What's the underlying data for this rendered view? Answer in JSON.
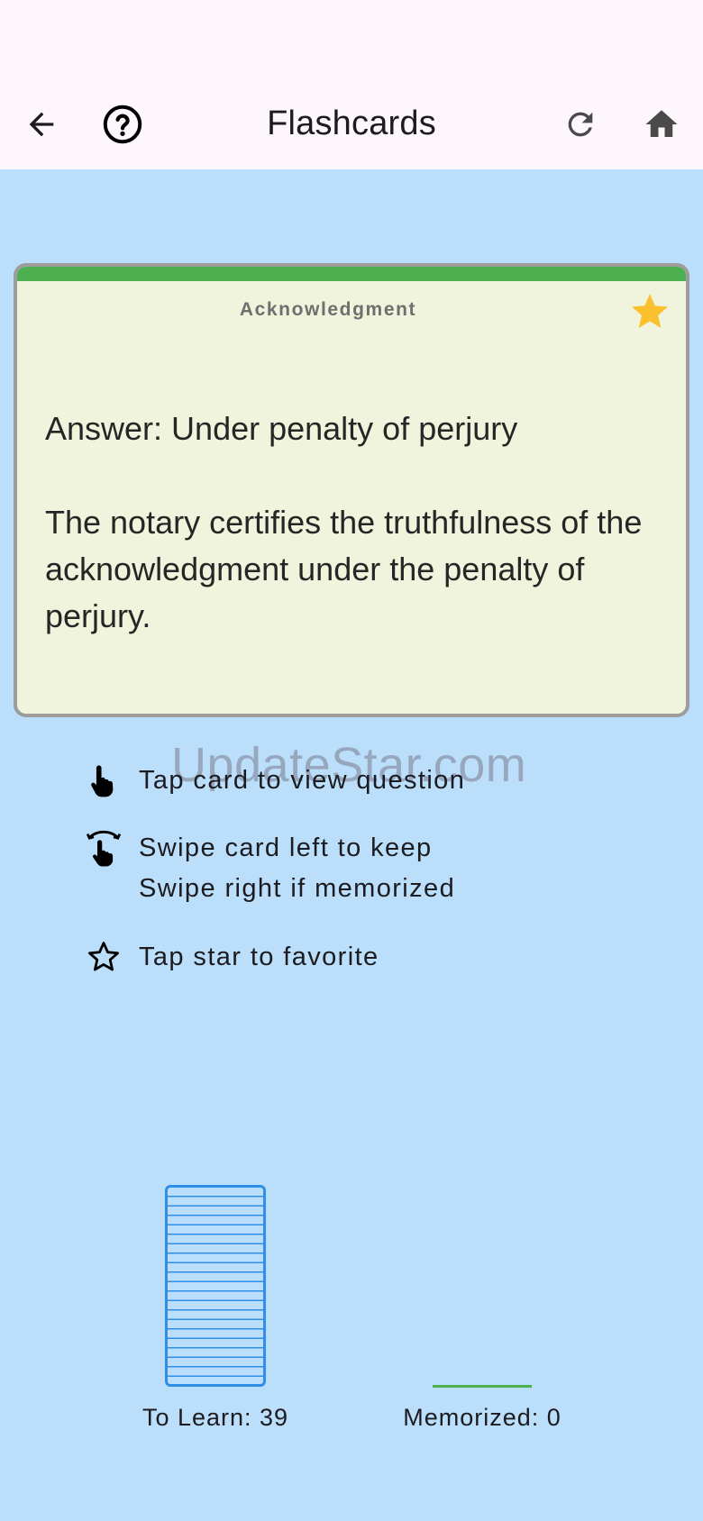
{
  "appbar": {
    "title": "Flashcards",
    "icons": [
      "back-arrow-icon",
      "help-circle-icon",
      "refresh-icon",
      "home-icon"
    ]
  },
  "card": {
    "category": "Acknowledgment",
    "answer": "Answer: Under penalty of perjury",
    "explanation": "The notary certifies the truthfulness of the acknowledgment under the penalty of perjury.",
    "favorited": true,
    "colors": {
      "top_bar": "#4caf50",
      "background": "#f0f4dc",
      "star": "#fbc02d"
    }
  },
  "watermark": "UpdateStar.com",
  "hints": [
    {
      "icon": "tap-hand-icon",
      "lines": [
        "Tap card to view question"
      ]
    },
    {
      "icon": "swipe-hand-icon",
      "lines": [
        "Swipe card left to keep",
        "Swipe right if memorized"
      ]
    },
    {
      "icon": "star-outline-icon",
      "lines": [
        "Tap star to favorite"
      ]
    }
  ],
  "piles": {
    "to_learn_label": "To Learn: 39",
    "memorized_label": "Memorized: 0",
    "to_learn_count": 39,
    "memorized_count": 0
  },
  "colors": {
    "background": "#bbdffb",
    "appbar": "#fdf7fd",
    "deck_blue": "#2f8fe6"
  }
}
